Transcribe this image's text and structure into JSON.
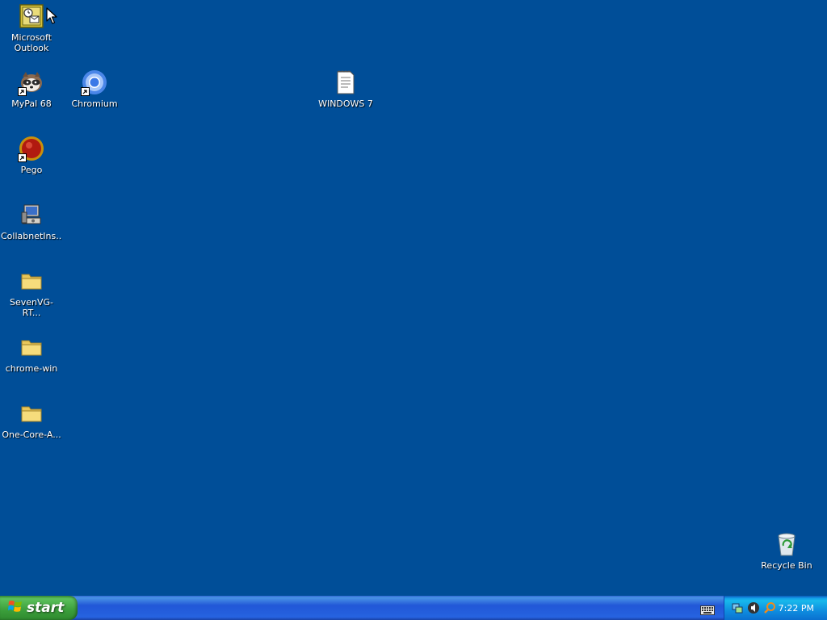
{
  "desktop": {
    "background_color": "#004e98",
    "icons": [
      {
        "label": "Microsoft\nOutlook",
        "icon": "outlook-icon"
      },
      {
        "label": "MyPal 68",
        "icon": "mypal-icon"
      },
      {
        "label": "Chromium",
        "icon": "chromium-icon"
      },
      {
        "label": "WINDOWS 7",
        "icon": "text-document-icon"
      },
      {
        "label": "Pego",
        "icon": "pego-icon"
      },
      {
        "label": "CollabnetIns...",
        "icon": "installer-icon"
      },
      {
        "label": "SevenVG-RT...",
        "icon": "folder-icon"
      },
      {
        "label": "chrome-win",
        "icon": "folder-icon"
      },
      {
        "label": "One-Core-A...",
        "icon": "folder-icon"
      },
      {
        "label": "Recycle Bin",
        "icon": "recycle-bin-icon"
      }
    ]
  },
  "taskbar": {
    "start_label": "start",
    "clock": "7:22 PM",
    "tray_icons": [
      "network-icon",
      "speaker-icon",
      "search-icon"
    ],
    "keyboard_icon": "keyboard-icon"
  }
}
